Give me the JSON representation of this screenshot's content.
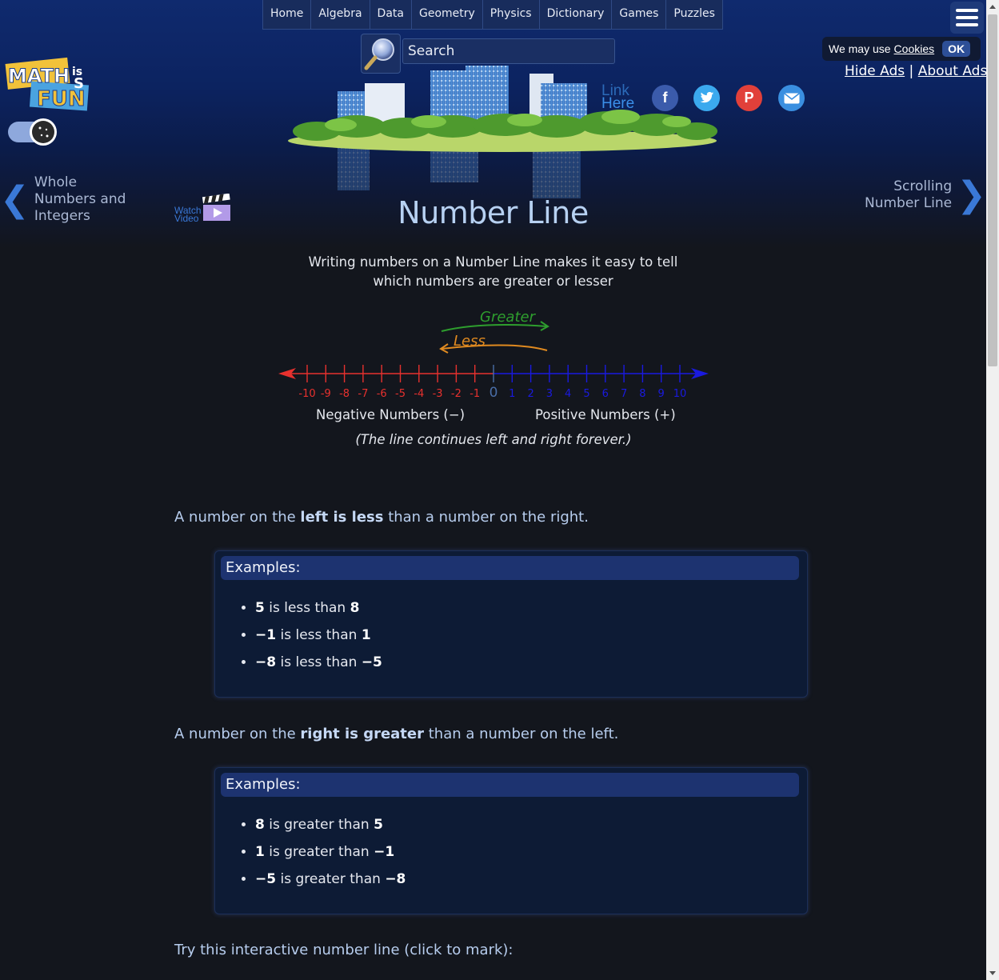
{
  "nav": {
    "items": [
      "Home",
      "Algebra",
      "Data",
      "Geometry",
      "Physics",
      "Dictionary",
      "Games",
      "Puzzles"
    ]
  },
  "search": {
    "placeholder": "Search"
  },
  "cookies": {
    "text": "We may use",
    "link": "Cookies",
    "ok": "OK"
  },
  "ads": {
    "hide": "Hide Ads",
    "separator": "|",
    "about": "About Ads"
  },
  "logo": {
    "text_maths": "MATH",
    "text_is": "is",
    "text_s": "S",
    "text_fun": "FUN"
  },
  "share": {
    "link_line1": "Link",
    "link_line2": "Here",
    "icons": [
      "facebook-icon",
      "twitter-icon",
      "pinterest-icon",
      "email-icon"
    ]
  },
  "prev_page": {
    "line1": "Whole",
    "line2": "Numbers and",
    "line3": "Integers"
  },
  "next_page": {
    "line1": "Scrolling",
    "line2": "Number Line"
  },
  "video": {
    "line1": "Watch",
    "line2": "Video"
  },
  "page_title": "Number Line",
  "intro": {
    "line1": "Writing numbers on a Number Line makes it easy to tell",
    "line2": "which numbers are greater or lesser"
  },
  "figure": {
    "greater": "Greater",
    "less": "Less",
    "negative_ticks": [
      "-10",
      "-9",
      "-8",
      "-7",
      "-6",
      "-5",
      "-4",
      "-3",
      "-2",
      "-1"
    ],
    "zero": "0",
    "positive_ticks": [
      "1",
      "2",
      "3",
      "4",
      "5",
      "6",
      "7",
      "8",
      "9",
      "10"
    ],
    "negative_label": "Negative Numbers (−)",
    "positive_label": "Positive Numbers (+)",
    "caption": "(The line continues left and right forever.)",
    "colors": {
      "negative": "#e8312e",
      "positive": "#1a1ae0",
      "zero": "#4a6ea8",
      "greater": "#2e9e2e",
      "less": "#e08a20"
    }
  },
  "section1": {
    "pre": "A number on the ",
    "bold": "left is less",
    "post": " than a number on the right."
  },
  "examples1": {
    "header": "Examples:",
    "items": [
      {
        "a": "5",
        "mid": " is less than ",
        "b": "8"
      },
      {
        "a": "−1",
        "mid": " is less than ",
        "b": "1"
      },
      {
        "a": "−8",
        "mid": " is less than ",
        "b": "−5"
      }
    ]
  },
  "section2": {
    "pre": "A number on the ",
    "bold": "right is greater",
    "post": " than a number on the left."
  },
  "examples2": {
    "header": "Examples:",
    "items": [
      {
        "a": "8",
        "mid": " is greater than ",
        "b": "5"
      },
      {
        "a": "1",
        "mid": " is greater than ",
        "b": "−1"
      },
      {
        "a": "−5",
        "mid": " is greater than ",
        "b": "−8"
      }
    ]
  },
  "section3": "Try this interactive number line (click to mark):"
}
